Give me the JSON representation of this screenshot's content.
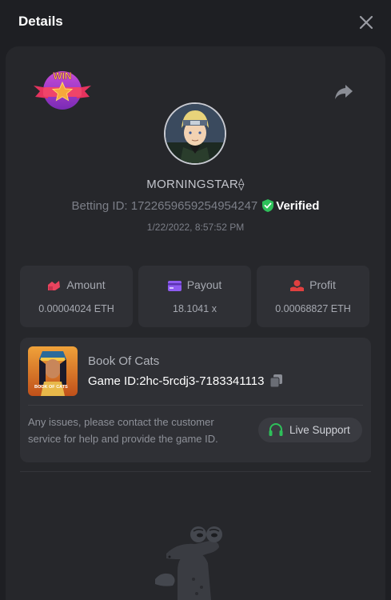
{
  "dialog": {
    "title": "Details"
  },
  "player": {
    "username": "MORNINGSTAR",
    "username_suffix": "⟠",
    "betting_id_label": "Betting ID:",
    "betting_id": "1722659659254954247",
    "verified_label": "Verified",
    "timestamp": "1/22/2022, 8:57:52 PM"
  },
  "badge": {
    "text": "WIN"
  },
  "stats": {
    "amount": {
      "label": "Amount",
      "value": "0.00004024 ETH"
    },
    "payout": {
      "label": "Payout",
      "value": "18.1041 x"
    },
    "profit": {
      "label": "Profit",
      "value": "0.00068827 ETH"
    }
  },
  "game": {
    "name": "Book Of Cats",
    "id_label": "Game ID:",
    "id": "2hc-5rcdj3-7183341113",
    "thumb_text": "BOOK OF CATS"
  },
  "support": {
    "message": "Any issues, please contact the customer service for help and provide the game ID.",
    "button_label": "Live Support"
  },
  "colors": {
    "verified": "#2ec05a",
    "amount_icon": "#e8445e",
    "payout_icon": "#8e5bf0",
    "profit_icon": "#e04040",
    "support_icon": "#2ec05a"
  }
}
